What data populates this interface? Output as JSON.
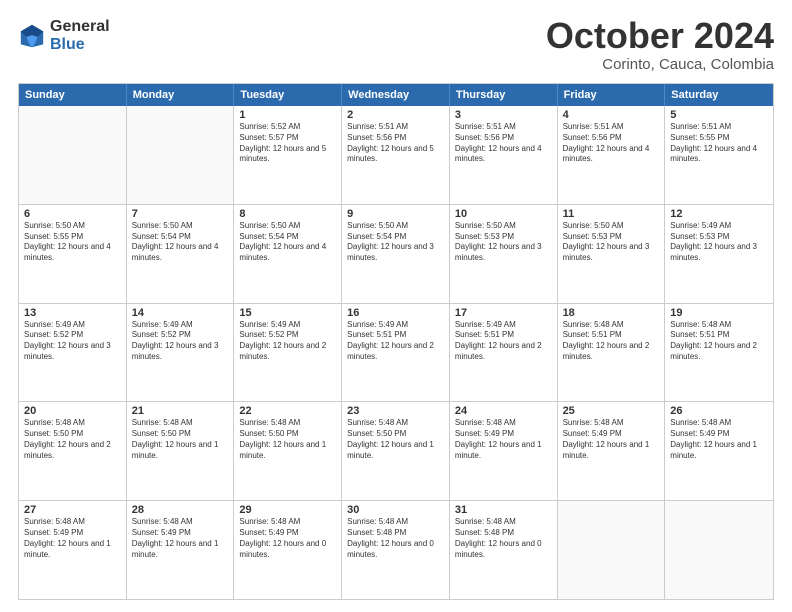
{
  "logo": {
    "general": "General",
    "blue": "Blue"
  },
  "title": {
    "month": "October 2024",
    "location": "Corinto, Cauca, Colombia"
  },
  "header_days": [
    "Sunday",
    "Monday",
    "Tuesday",
    "Wednesday",
    "Thursday",
    "Friday",
    "Saturday"
  ],
  "rows": [
    [
      {
        "day": "",
        "empty": true
      },
      {
        "day": "",
        "empty": true
      },
      {
        "day": "1",
        "sunrise": "Sunrise: 5:52 AM",
        "sunset": "Sunset: 5:57 PM",
        "daylight": "Daylight: 12 hours and 5 minutes."
      },
      {
        "day": "2",
        "sunrise": "Sunrise: 5:51 AM",
        "sunset": "Sunset: 5:56 PM",
        "daylight": "Daylight: 12 hours and 5 minutes."
      },
      {
        "day": "3",
        "sunrise": "Sunrise: 5:51 AM",
        "sunset": "Sunset: 5:56 PM",
        "daylight": "Daylight: 12 hours and 4 minutes."
      },
      {
        "day": "4",
        "sunrise": "Sunrise: 5:51 AM",
        "sunset": "Sunset: 5:56 PM",
        "daylight": "Daylight: 12 hours and 4 minutes."
      },
      {
        "day": "5",
        "sunrise": "Sunrise: 5:51 AM",
        "sunset": "Sunset: 5:55 PM",
        "daylight": "Daylight: 12 hours and 4 minutes."
      }
    ],
    [
      {
        "day": "6",
        "sunrise": "Sunrise: 5:50 AM",
        "sunset": "Sunset: 5:55 PM",
        "daylight": "Daylight: 12 hours and 4 minutes."
      },
      {
        "day": "7",
        "sunrise": "Sunrise: 5:50 AM",
        "sunset": "Sunset: 5:54 PM",
        "daylight": "Daylight: 12 hours and 4 minutes."
      },
      {
        "day": "8",
        "sunrise": "Sunrise: 5:50 AM",
        "sunset": "Sunset: 5:54 PM",
        "daylight": "Daylight: 12 hours and 4 minutes."
      },
      {
        "day": "9",
        "sunrise": "Sunrise: 5:50 AM",
        "sunset": "Sunset: 5:54 PM",
        "daylight": "Daylight: 12 hours and 3 minutes."
      },
      {
        "day": "10",
        "sunrise": "Sunrise: 5:50 AM",
        "sunset": "Sunset: 5:53 PM",
        "daylight": "Daylight: 12 hours and 3 minutes."
      },
      {
        "day": "11",
        "sunrise": "Sunrise: 5:50 AM",
        "sunset": "Sunset: 5:53 PM",
        "daylight": "Daylight: 12 hours and 3 minutes."
      },
      {
        "day": "12",
        "sunrise": "Sunrise: 5:49 AM",
        "sunset": "Sunset: 5:53 PM",
        "daylight": "Daylight: 12 hours and 3 minutes."
      }
    ],
    [
      {
        "day": "13",
        "sunrise": "Sunrise: 5:49 AM",
        "sunset": "Sunset: 5:52 PM",
        "daylight": "Daylight: 12 hours and 3 minutes."
      },
      {
        "day": "14",
        "sunrise": "Sunrise: 5:49 AM",
        "sunset": "Sunset: 5:52 PM",
        "daylight": "Daylight: 12 hours and 3 minutes."
      },
      {
        "day": "15",
        "sunrise": "Sunrise: 5:49 AM",
        "sunset": "Sunset: 5:52 PM",
        "daylight": "Daylight: 12 hours and 2 minutes."
      },
      {
        "day": "16",
        "sunrise": "Sunrise: 5:49 AM",
        "sunset": "Sunset: 5:51 PM",
        "daylight": "Daylight: 12 hours and 2 minutes."
      },
      {
        "day": "17",
        "sunrise": "Sunrise: 5:49 AM",
        "sunset": "Sunset: 5:51 PM",
        "daylight": "Daylight: 12 hours and 2 minutes."
      },
      {
        "day": "18",
        "sunrise": "Sunrise: 5:48 AM",
        "sunset": "Sunset: 5:51 PM",
        "daylight": "Daylight: 12 hours and 2 minutes."
      },
      {
        "day": "19",
        "sunrise": "Sunrise: 5:48 AM",
        "sunset": "Sunset: 5:51 PM",
        "daylight": "Daylight: 12 hours and 2 minutes."
      }
    ],
    [
      {
        "day": "20",
        "sunrise": "Sunrise: 5:48 AM",
        "sunset": "Sunset: 5:50 PM",
        "daylight": "Daylight: 12 hours and 2 minutes."
      },
      {
        "day": "21",
        "sunrise": "Sunrise: 5:48 AM",
        "sunset": "Sunset: 5:50 PM",
        "daylight": "Daylight: 12 hours and 1 minute."
      },
      {
        "day": "22",
        "sunrise": "Sunrise: 5:48 AM",
        "sunset": "Sunset: 5:50 PM",
        "daylight": "Daylight: 12 hours and 1 minute."
      },
      {
        "day": "23",
        "sunrise": "Sunrise: 5:48 AM",
        "sunset": "Sunset: 5:50 PM",
        "daylight": "Daylight: 12 hours and 1 minute."
      },
      {
        "day": "24",
        "sunrise": "Sunrise: 5:48 AM",
        "sunset": "Sunset: 5:49 PM",
        "daylight": "Daylight: 12 hours and 1 minute."
      },
      {
        "day": "25",
        "sunrise": "Sunrise: 5:48 AM",
        "sunset": "Sunset: 5:49 PM",
        "daylight": "Daylight: 12 hours and 1 minute."
      },
      {
        "day": "26",
        "sunrise": "Sunrise: 5:48 AM",
        "sunset": "Sunset: 5:49 PM",
        "daylight": "Daylight: 12 hours and 1 minute."
      }
    ],
    [
      {
        "day": "27",
        "sunrise": "Sunrise: 5:48 AM",
        "sunset": "Sunset: 5:49 PM",
        "daylight": "Daylight: 12 hours and 1 minute."
      },
      {
        "day": "28",
        "sunrise": "Sunrise: 5:48 AM",
        "sunset": "Sunset: 5:49 PM",
        "daylight": "Daylight: 12 hours and 1 minute."
      },
      {
        "day": "29",
        "sunrise": "Sunrise: 5:48 AM",
        "sunset": "Sunset: 5:49 PM",
        "daylight": "Daylight: 12 hours and 0 minutes."
      },
      {
        "day": "30",
        "sunrise": "Sunrise: 5:48 AM",
        "sunset": "Sunset: 5:48 PM",
        "daylight": "Daylight: 12 hours and 0 minutes."
      },
      {
        "day": "31",
        "sunrise": "Sunrise: 5:48 AM",
        "sunset": "Sunset: 5:48 PM",
        "daylight": "Daylight: 12 hours and 0 minutes."
      },
      {
        "day": "",
        "empty": true
      },
      {
        "day": "",
        "empty": true
      }
    ]
  ]
}
